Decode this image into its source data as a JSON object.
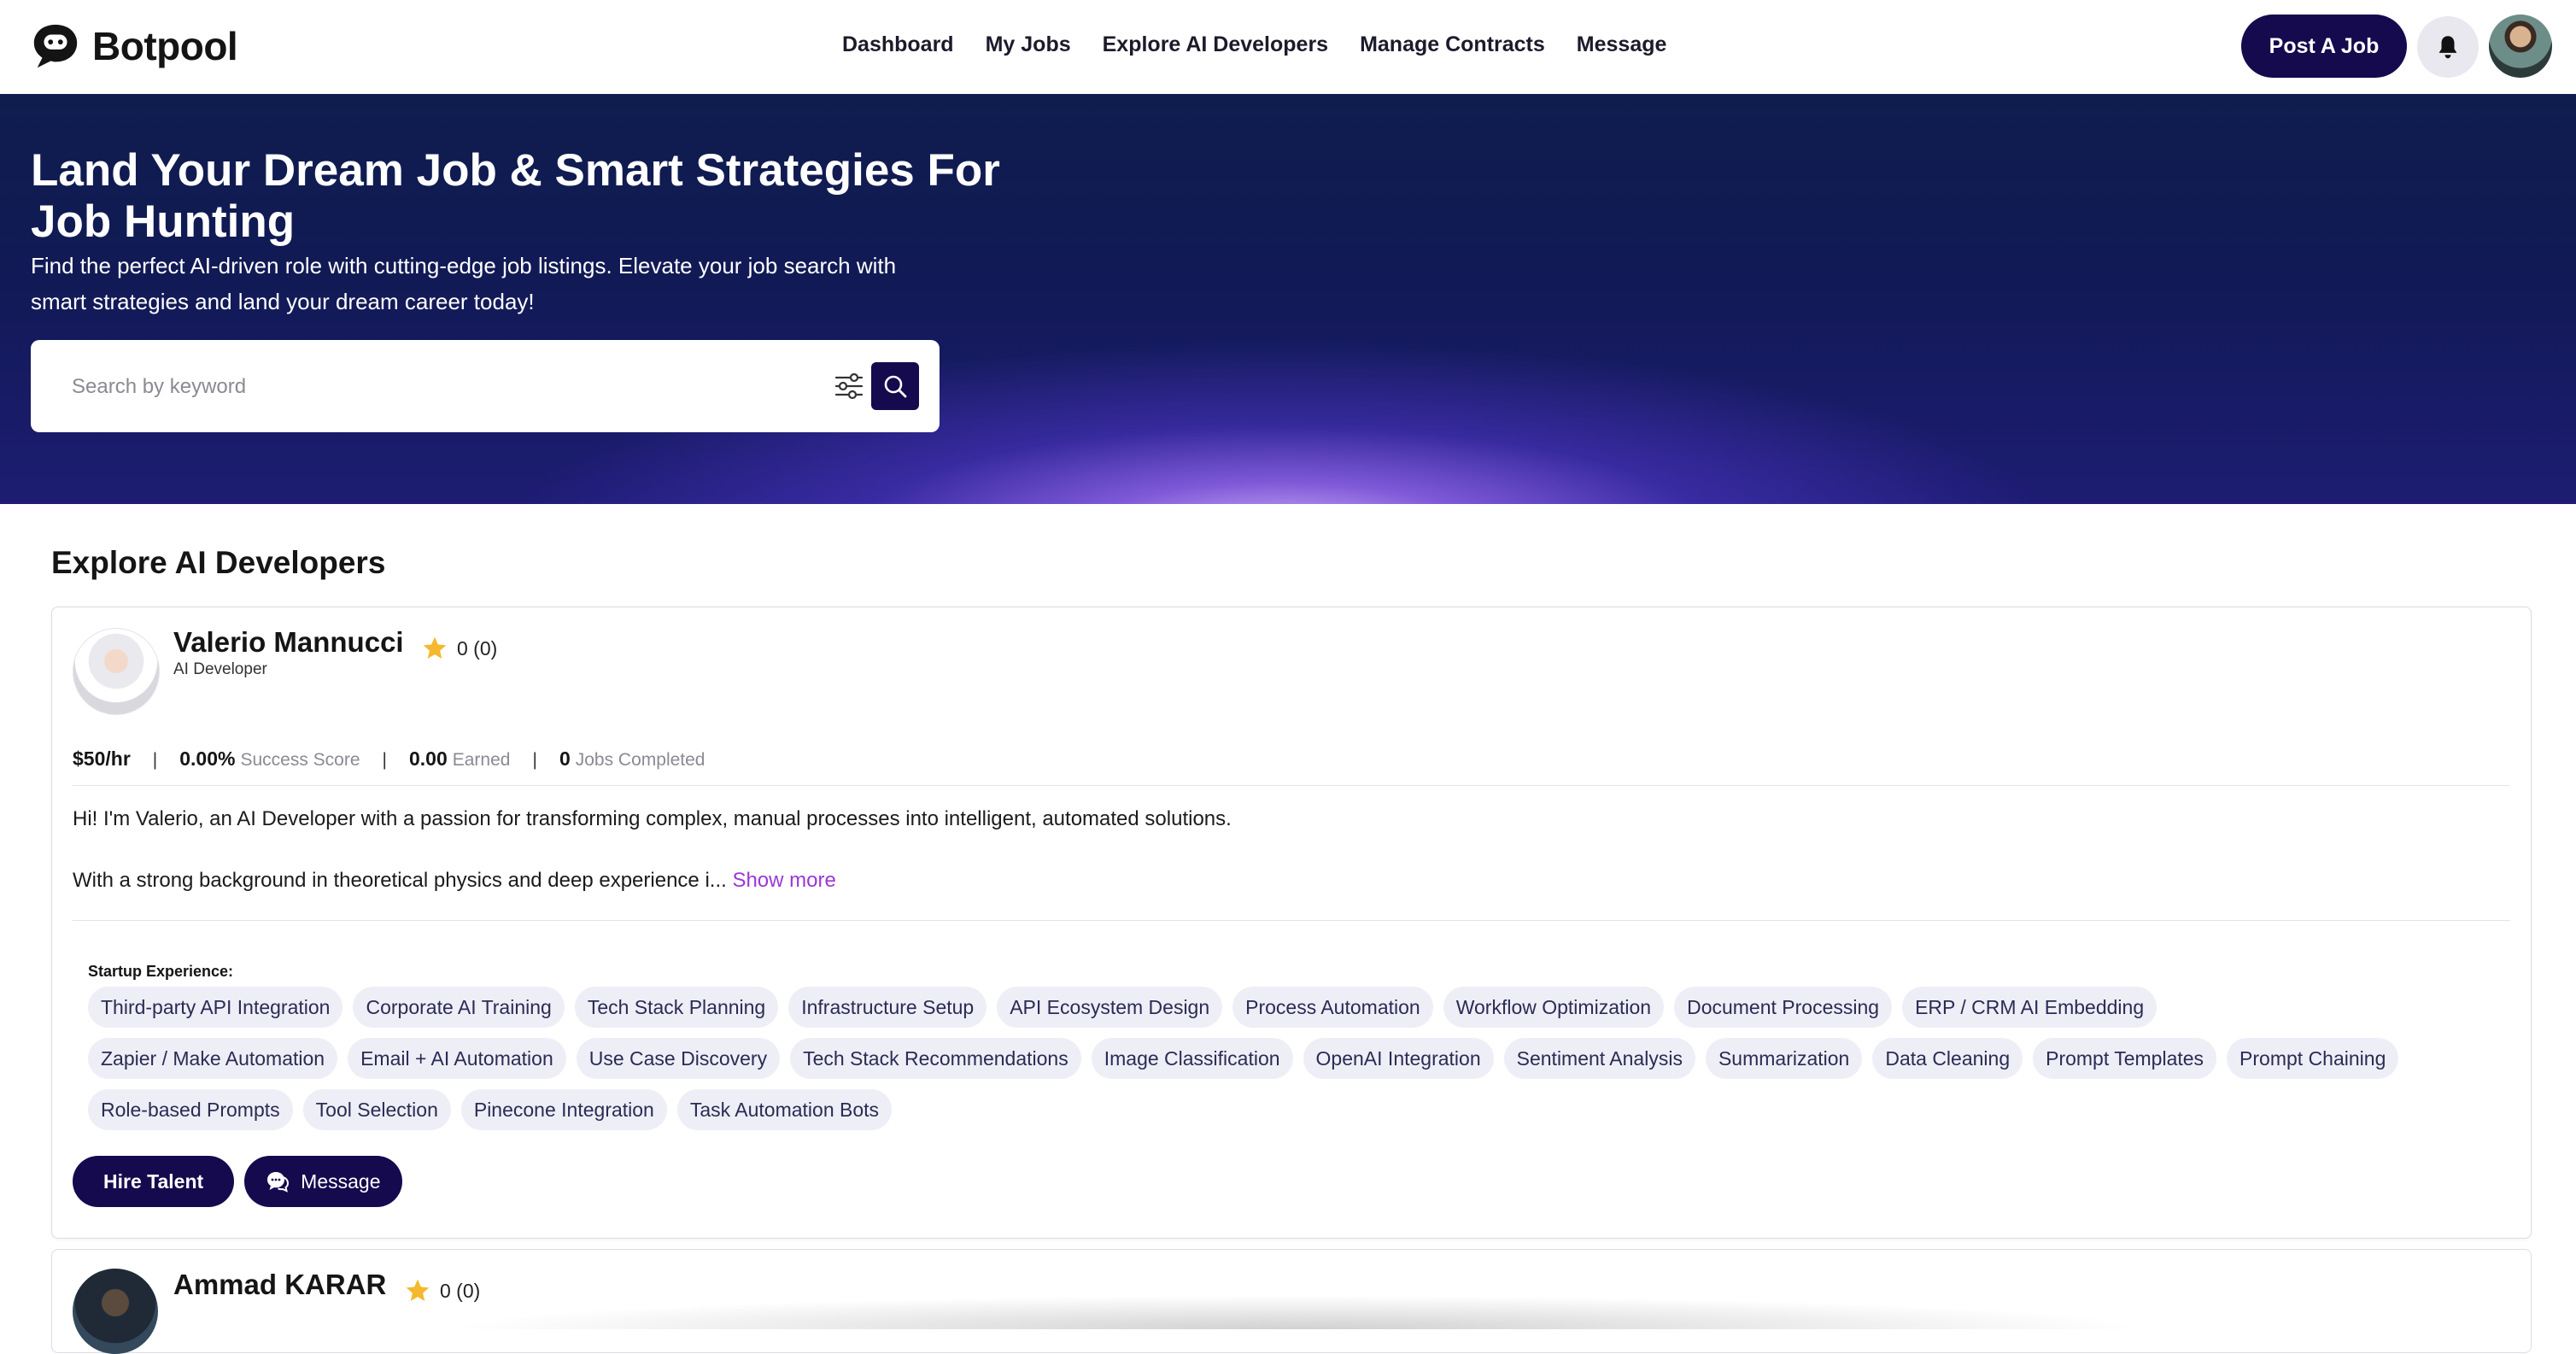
{
  "app": {
    "brand": "Botpool"
  },
  "nav": {
    "links": [
      "Dashboard",
      "My Jobs",
      "Explore AI Developers",
      "Manage Contracts",
      "Message"
    ],
    "post_job_label": "Post A Job"
  },
  "hero": {
    "title": "Land Your Dream Job & Smart Strategies For Job Hunting",
    "subtitle": "Find the perfect AI-driven role with cutting-edge job listings. Elevate your job search with smart strategies and land your dream career today!",
    "search_placeholder": "Search by keyword"
  },
  "main": {
    "section_title": "Explore AI Developers"
  },
  "developers": [
    {
      "name": "Valerio Mannucci",
      "role": "AI Developer",
      "rating": "0 (0)",
      "rate": "$50/hr",
      "success_value": "0.00%",
      "success_label": "Success Score",
      "earned_value": "0.00",
      "earned_label": "Earned",
      "jobs_value": "0",
      "jobs_label": "Jobs Completed",
      "bio_line1": "Hi! I'm Valerio, an AI Developer with a passion for transforming complex, manual processes into intelligent, automated solutions.",
      "bio_line2": "With a strong background in theoretical physics and deep experience i...",
      "show_more": "Show more",
      "skills_label": "Startup Experience:",
      "skills_row1": [
        "Third-party API Integration",
        "Corporate AI Training",
        "Tech Stack Planning",
        "Infrastructure Setup",
        "API Ecosystem Design",
        "Process Automation",
        "Workflow Optimization",
        "Document Processing",
        "ERP / CRM AI Embedding"
      ],
      "skills_row2": [
        "Zapier / Make Automation",
        "Email + AI Automation",
        "Use Case Discovery",
        "Tech Stack Recommendations",
        "Image Classification",
        "OpenAI Integration",
        "Sentiment Analysis",
        "Summarization",
        "Data Cleaning",
        "Prompt Templates",
        "Prompt Chaining"
      ],
      "skills_row3": [
        "Role-based Prompts",
        "Tool Selection",
        "Pinecone Integration",
        "Task Automation Bots"
      ],
      "hire_label": "Hire Talent",
      "message_label": "Message"
    },
    {
      "name": "Ammad KARAR",
      "rating": "0 (0)"
    }
  ],
  "colors": {
    "primary": "#150a4e",
    "accent_link": "#9b37d6",
    "star": "#f5b82e",
    "chip_bg": "#eeeef6"
  },
  "icons": [
    "botpool-logo-icon",
    "bell-icon",
    "filter-icon",
    "search-icon",
    "star-icon",
    "chat-icon"
  ]
}
